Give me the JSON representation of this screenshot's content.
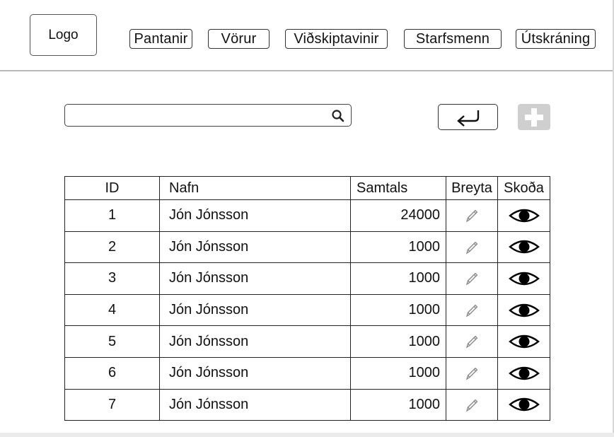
{
  "header": {
    "logo": "Logo",
    "nav": [
      {
        "label": "Pantanir",
        "name": "nav-pantanir"
      },
      {
        "label": "Vörur",
        "name": "nav-vorur"
      },
      {
        "label": "Viðskiptavinir",
        "name": "nav-vidskiptavinir"
      },
      {
        "label": "Starfsmenn",
        "name": "nav-starfsmenn"
      },
      {
        "label": "Útskráning",
        "name": "nav-utskraning"
      }
    ]
  },
  "toolbar": {
    "search": {
      "value": "",
      "placeholder": "",
      "icon": "search-icon"
    },
    "back_icon": "return-arrow-icon",
    "add_icon": "plus-icon",
    "add_color": "#cfcfcf"
  },
  "table": {
    "columns": [
      "ID",
      "Nafn",
      "Samtals",
      "Breyta",
      "Skoða"
    ],
    "rows": [
      {
        "id": "1",
        "name": "Jón Jónsson",
        "total": "24000"
      },
      {
        "id": "2",
        "name": "Jón Jónsson",
        "total": "1000"
      },
      {
        "id": "3",
        "name": "Jón Jónsson",
        "total": "1000"
      },
      {
        "id": "4",
        "name": "Jón Jónsson",
        "total": "1000"
      },
      {
        "id": "5",
        "name": "Jón Jónsson",
        "total": "1000"
      },
      {
        "id": "6",
        "name": "Jón Jónsson",
        "total": "1000"
      },
      {
        "id": "7",
        "name": "Jón Jónsson",
        "total": "1000"
      }
    ],
    "edit_icon": "pencil-icon",
    "view_icon": "eye-icon"
  }
}
